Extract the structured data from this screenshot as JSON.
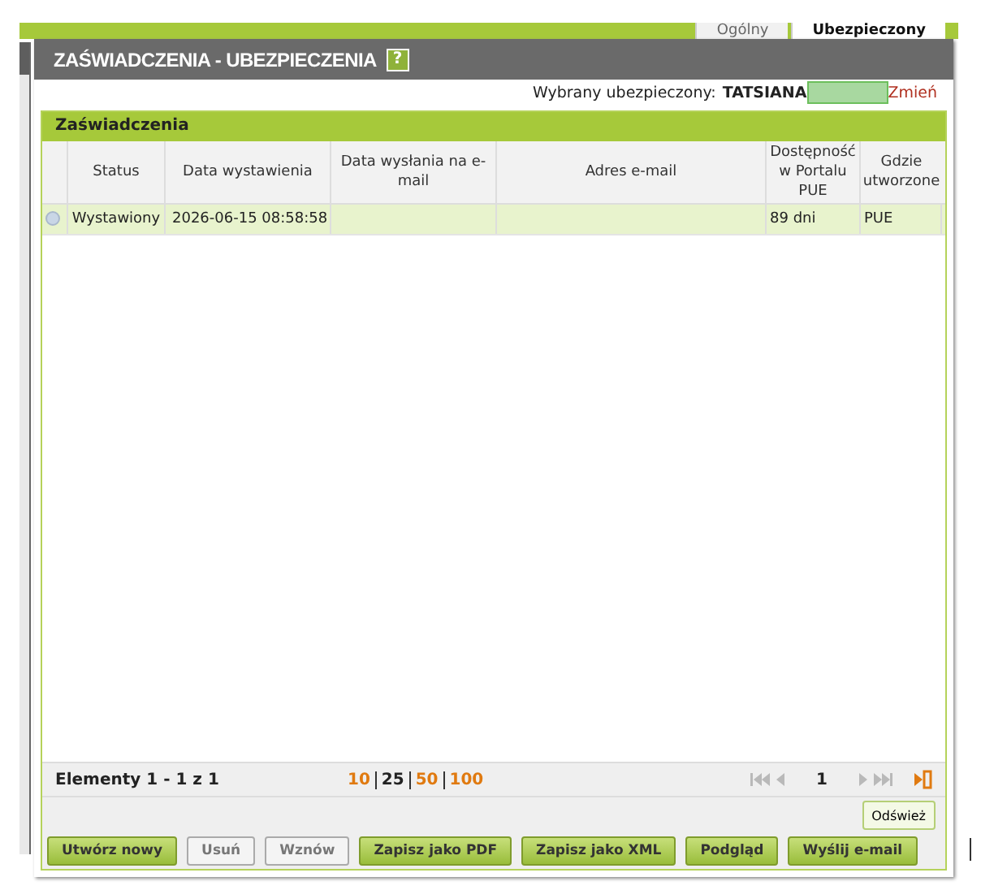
{
  "tabs": [
    {
      "label": "Ogólny",
      "selected": false
    },
    {
      "label": "Ubezpieczony",
      "selected": true
    }
  ],
  "dialog": {
    "title": "ZAŚWIADCZENIA - UBEZPIECZENIA",
    "help": "?",
    "insured_label": "Wybrany ubezpieczony:",
    "insured_name": "TATSIANA",
    "change_link": "Zmień"
  },
  "section": {
    "title": "Zaświadczenia"
  },
  "table": {
    "columns": [
      "Status",
      "Data wystawienia",
      "Data wysłania na e-mail",
      "Adres e-mail",
      "Dostępność w Portalu PUE",
      "Gdzie utworzone"
    ],
    "rows": [
      {
        "selected": true,
        "cells": [
          "Wystawiony",
          "2026-06-15 08:58:58",
          "",
          "",
          "89 dni",
          "PUE"
        ]
      }
    ]
  },
  "pager": {
    "summary": "Elementy 1 - 1 z 1",
    "sizes": [
      {
        "label": "10",
        "selected": false
      },
      {
        "label": "25",
        "selected": true
      },
      {
        "label": "50",
        "selected": false
      },
      {
        "label": "100",
        "selected": false
      }
    ],
    "page": "1"
  },
  "refresh_button": "Odśwież",
  "buttons": [
    {
      "label": "Utwórz nowy",
      "disabled": false
    },
    {
      "label": "Usuń",
      "disabled": true
    },
    {
      "label": "Wznów",
      "disabled": true
    },
    {
      "label": "Zapisz jako PDF",
      "disabled": false
    },
    {
      "label": "Zapisz jako XML",
      "disabled": false
    },
    {
      "label": "Podgląd",
      "disabled": false
    },
    {
      "label": "Wyślij e-mail",
      "disabled": false
    }
  ]
}
